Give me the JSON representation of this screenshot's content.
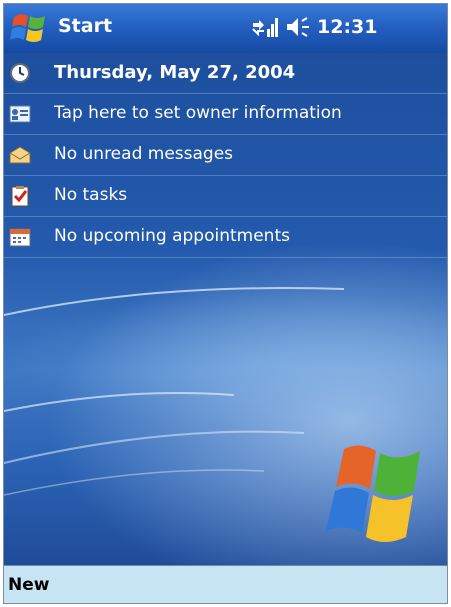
{
  "topbar": {
    "start_label": "Start",
    "time": "12:31",
    "icons": [
      "windows-flag-icon",
      "connectivity-icon",
      "speaker-icon"
    ]
  },
  "today": {
    "date": "Thursday, May 27, 2004",
    "owner_info": "Tap here to set owner information",
    "messages": "No unread messages",
    "tasks": "No tasks",
    "appointments": "No upcoming appointments"
  },
  "softkeys": {
    "left": "New"
  },
  "colors": {
    "topbar": "#2460c2",
    "background": "#245aad",
    "softbar": "#c6e4f2"
  }
}
